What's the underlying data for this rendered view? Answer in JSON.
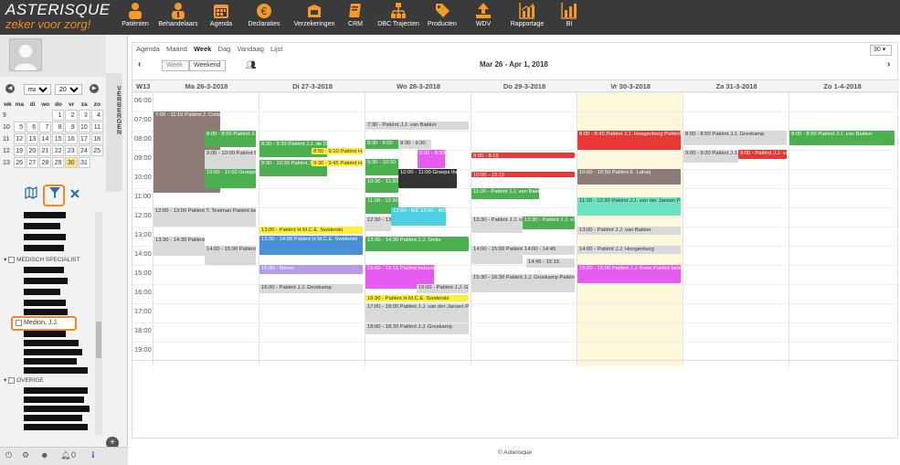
{
  "app": {
    "logo_line1": "ASTERISQUE",
    "logo_line2": "zeker voor zorg!",
    "footer": "© Asterisque"
  },
  "nav": [
    {
      "label": "Patiënten",
      "icon": "patients-icon"
    },
    {
      "label": "Behandelaars",
      "icon": "practitioners-icon"
    },
    {
      "label": "Agenda",
      "icon": "calendar-icon"
    },
    {
      "label": "Declaraties",
      "icon": "euro-icon"
    },
    {
      "label": "Verzekeringen",
      "icon": "insurance-icon"
    },
    {
      "label": "CRM",
      "icon": "book-icon"
    },
    {
      "label": "DBC Trajecten",
      "icon": "hierarchy-icon"
    },
    {
      "label": "Producten",
      "icon": "tag-icon"
    },
    {
      "label": "WDV",
      "icon": "upload-icon"
    },
    {
      "label": "Rapportage",
      "icon": "chart-icon"
    },
    {
      "label": "BI",
      "icon": "bi-chart-icon"
    }
  ],
  "colors": {
    "accent": "#f08a24",
    "topbar": "#3a3a3a",
    "today_col": "#fdf8dc"
  },
  "sidebar": {
    "verbergen": "VERBERGEN",
    "month_select": "maa",
    "year_select": "2018",
    "weekdays": [
      "wk",
      "ma",
      "di",
      "wo",
      "do",
      "vr",
      "za",
      "zo"
    ],
    "weeks": [
      [
        "9",
        "",
        "",
        "",
        "1",
        "2",
        "3",
        "4"
      ],
      [
        "10",
        "5",
        "6",
        "7",
        "8",
        "9",
        "10",
        "11"
      ],
      [
        "11",
        "12",
        "13",
        "14",
        "15",
        "16",
        "17",
        "18"
      ],
      [
        "12",
        "19",
        "20",
        "21",
        "22",
        "23",
        "24",
        "25"
      ],
      [
        "13",
        "26",
        "27",
        "28",
        "29",
        "30",
        "31",
        ""
      ]
    ],
    "today": "30",
    "group_specialist": "MEDISCH SPECIALIST",
    "group_overige": "OVERIGE",
    "selected_person": "Medion, J.J.",
    "notifications": "0"
  },
  "calendar": {
    "view_tabs": [
      "Agenda",
      "Maand",
      "Week",
      "Dag",
      "Vandaag",
      "Lijst"
    ],
    "active_view": "Week",
    "btn_week": "Week",
    "btn_weekend": "Weekend",
    "date_range": "Mar 26 - Apr 1, 2018",
    "zoom": "30",
    "week_label": "W13",
    "days": [
      "Ma 26-3-2018",
      "Di 27-3-2018",
      "Wo 28-3-2018",
      "Do 29-3-2018",
      "Vr 30-3-2018",
      "Za 31-3-2018",
      "Zo 1-4-2018"
    ],
    "hours": [
      "06:00",
      "07:00",
      "08:00",
      "09:00",
      "10:00",
      "11:00",
      "12:00",
      "13:00",
      "14:00",
      "15:00",
      "16:00",
      "17:00",
      "18:00",
      "19:00"
    ],
    "events": {
      "mon1": "7:00 - 11:15  Patiënt J. Collombon  Patiënt behandeling  Hoofdlocatie  5",
      "mon2": "8:00 - 8:50  Patiënt J.J. de Dijk-",
      "mon3": "9:00 - 10:00  Patiënt B. Geuman",
      "mon4": "10:00 - 11:00  Groeps therapie  Test reserveringen",
      "mon5": "12:00 - 13:00  Patiënt T. Testman  Patiënt behandeling",
      "mon6": "13:30 - 14:30  Patiënt T. Testman  Patiënt behandeling",
      "mon7": "14:00 - 15:00  Patiënt T. Testman",
      "tue1": "8:30 - 9:30  Patiënt J.J. de Dijk-Krautscheid",
      "tue2": "9:30 - 10:30  Patiënt J.J. de Dijk-Krautscheid",
      "tue3": "8:50 - 9:10  Patiënt H.M.C.E.",
      "tue4": "9:30 - 9:45  Patiënt H.M.C.E.",
      "tue5": "13:00 - Patiënt H.M.C.E. Swiderski",
      "tue6": "13:30 - 14:00  Patiënt H.M.C.E. Swiderski",
      "tue7": "15:00 - Memo",
      "tue8": "16:00 - Patiënt J.J. Groskamp",
      "wed1": "7:30 - Patiënt J.J. van Bakker",
      "wed2": "8:30 - 9:00",
      "wed3": "8:30 - 9:30",
      "wed4": "9:00 - 9:30",
      "wed5": "9:30 - 10:30",
      "wed6": "10:00 - 11:00  Groeps therapie  Test reserveringen",
      "wed7": "10:30 - 11:30  Patiënt J.J. Smits",
      "wed8": "11:30 - 12:30  Patiënt behandeling",
      "wed9": "12:00 - MDO 2",
      "wed10": "12:00 - MDO 2",
      "wed11": "12:30 - 13:00",
      "wed12": "13:30 - 14:30  Patiënt J.J. Smits",
      "wed13": "15:00 - 16:15  Patiënt behandeling  Hoofdlocatie",
      "wed14": "16:00 - Patiënt J.J. Groskamp",
      "wed15": "16:30 - Patiënt H.M.C.E. Swiderski",
      "wed16": "17:00 - 18:00  Patiënt J.J. van der Jansen  Patiënt behandeling",
      "wed17": "18:00 - 18:30  Patiënt J.J. Groskamp",
      "thu1": "9:00 - 9:15",
      "thu2": "10:00 - 10:15",
      "thu3": "11:00 - Patiënt J.J. van Bakker",
      "thu4": "13:30 - Patiënt J.J. van",
      "thu5": "13:30 - Patiënt J.J. van",
      "thu6": "14:00 - 15:00  Patiënt J.J. van",
      "thu7": "14:00 - 14:45",
      "thu8": "14:45 - 15:15",
      "thu9": "15:30 - 16:30  Patiënt J.J. Groskamp  Patiënt behandeling",
      "fri1": "8:00 - 8:45  Patiënt J.J. Hoogenberg  Patiënt behandeling",
      "fri2": "10:00 - 10:50  Patiënt E. Lahaij",
      "fri3": "11:30 - 12:30  Patiënt J.J. van der Jansen  Patiënt behandeling",
      "fri4": "13:00 - Patiënt J.J. van Bakker",
      "fri5": "14:00 - Patiënt J.J. Hoogenberg",
      "fri6": "15:00 - 16:00  Patiënt J.J. Bees  Patiënt behandeling",
      "sat1": "8:00 - 8:50  Patiënt J.J. Groskamp",
      "sat2": "9:00 - 9:30  Patiënt J.J. Groskamp",
      "sat3": "9:00 - Patiënt J.J. van",
      "sun1": "8:00 - 8:50  Patiënt J.J. van Bakker"
    }
  }
}
